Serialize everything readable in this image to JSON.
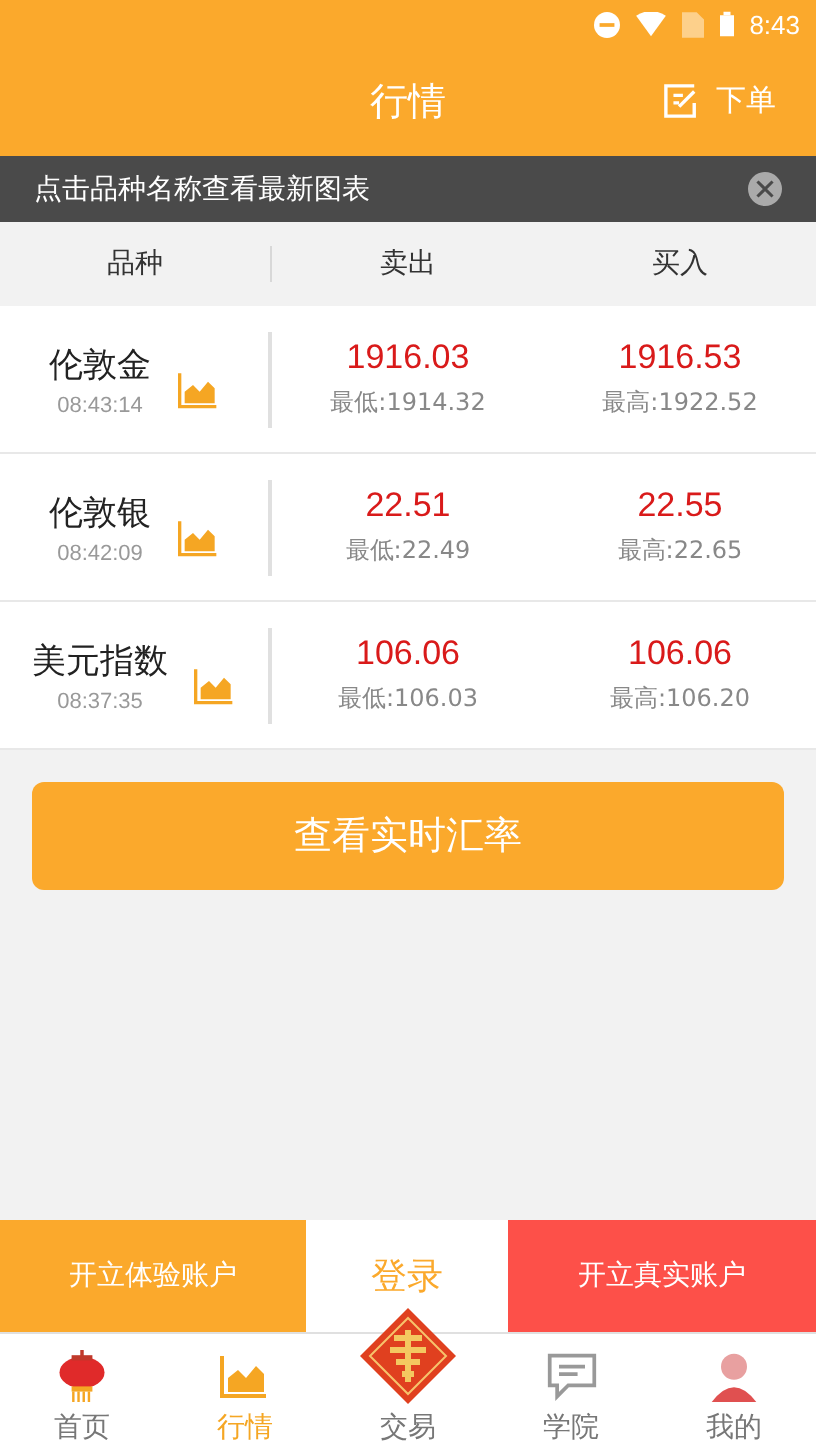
{
  "status_bar": {
    "time": "8:43"
  },
  "header": {
    "title": "行情",
    "action": "下单"
  },
  "notice": {
    "text": "点击品种名称查看最新图表"
  },
  "table": {
    "columns": [
      "品种",
      "卖出",
      "买入"
    ],
    "rows": [
      {
        "name": "伦敦金",
        "time": "08:43:14",
        "sell": "1916.03",
        "sell_low": "最低:1914.32",
        "buy": "1916.53",
        "buy_high": "最高:1922.52"
      },
      {
        "name": "伦敦银",
        "time": "08:42:09",
        "sell": "22.51",
        "sell_low": "最低:22.49",
        "buy": "22.55",
        "buy_high": "最高:22.65"
      },
      {
        "name": "美元指数",
        "time": "08:37:35",
        "sell": "106.06",
        "sell_low": "最低:106.03",
        "buy": "106.06",
        "buy_high": "最高:106.20"
      }
    ]
  },
  "main_button": "查看实时汇率",
  "action_bar": [
    {
      "label": "开立体验账户",
      "kind": "demo"
    },
    {
      "label": "登录",
      "kind": "login"
    },
    {
      "label": "开立真实账户",
      "kind": "real"
    }
  ],
  "nav": [
    {
      "label": "首页",
      "kind": "lantern",
      "selected": false
    },
    {
      "label": "行情",
      "kind": "chart",
      "selected": true
    },
    {
      "label": "交易",
      "kind": "badge",
      "selected": false
    },
    {
      "label": "学院",
      "kind": "chat",
      "selected": false
    },
    {
      "label": "我的",
      "kind": "person",
      "selected": false
    }
  ]
}
